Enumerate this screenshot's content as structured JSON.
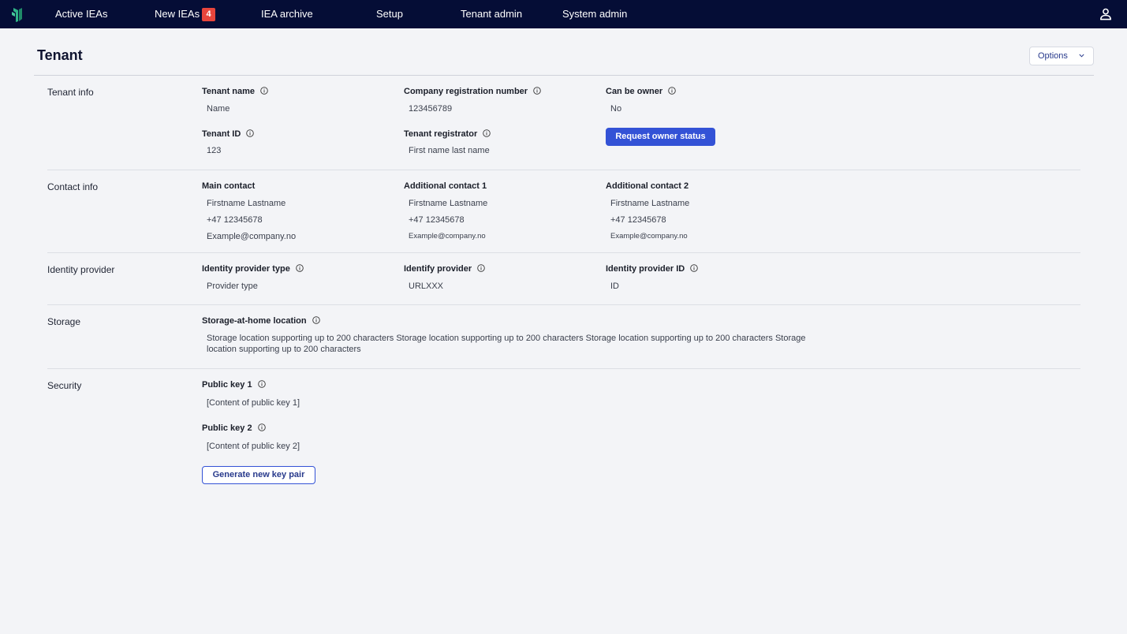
{
  "nav": {
    "items": [
      {
        "label": "Active IEAs"
      },
      {
        "label": "New IEAs",
        "badge": "4"
      },
      {
        "label": "IEA archive"
      },
      {
        "label": "Setup"
      },
      {
        "label": "Tenant admin"
      },
      {
        "label": "System admin"
      }
    ]
  },
  "header": {
    "title": "Tenant",
    "options_label": "Options"
  },
  "sections": {
    "tenant_info": {
      "title": "Tenant  info",
      "tenant_name_label": "Tenant name",
      "tenant_name_value": "Name",
      "company_reg_label": "Company registration number",
      "company_reg_value": "123456789",
      "can_be_owner_label": "Can be owner",
      "can_be_owner_value": "No",
      "tenant_id_label": "Tenant ID",
      "tenant_id_value": "123",
      "tenant_registrator_label": "Tenant registrator",
      "tenant_registrator_value": "First name last name",
      "request_owner_button": "Request owner status"
    },
    "contact_info": {
      "title": "Contact info",
      "main": {
        "label": "Main contact",
        "name": "Firstname Lastname",
        "phone": "+47 12345678",
        "email": "Example@company.no"
      },
      "additional1": {
        "label": "Additional contact 1",
        "name": "Firstname Lastname",
        "phone": "+47 12345678",
        "email": "Example@company.no"
      },
      "additional2": {
        "label": "Additional contact 2",
        "name": "Firstname Lastname",
        "phone": "+47 12345678",
        "email": "Example@company.no"
      }
    },
    "identity_provider": {
      "title": "Identity provider",
      "type_label": "Identity provider type",
      "type_value": "Provider type",
      "provider_label": "Identify provider",
      "provider_value": "URLXXX",
      "id_label": "Identity provider ID",
      "id_value": "ID"
    },
    "storage": {
      "title": "Storage",
      "location_label": "Storage-at-home location",
      "location_value": "Storage location supporting up to 200 characters  Storage location supporting up to 200 characters  Storage location supporting up to 200 characters  Storage location supporting up to 200 characters"
    },
    "security": {
      "title": "Security",
      "key1_label": "Public key 1",
      "key1_value": "[Content of public key 1]",
      "key2_label": "Public key 2",
      "key2_value": "[Content of public key 2]",
      "generate_button": "Generate new key pair"
    }
  },
  "colors": {
    "nav_bg": "#050d36",
    "primary": "#3352d6",
    "badge": "#e8453c",
    "page_bg": "#f3f4f7"
  },
  "icons": {
    "logo": "brand-logo-icon",
    "user": "user-icon",
    "info": "info-icon",
    "chevron": "chevron-down-icon"
  }
}
